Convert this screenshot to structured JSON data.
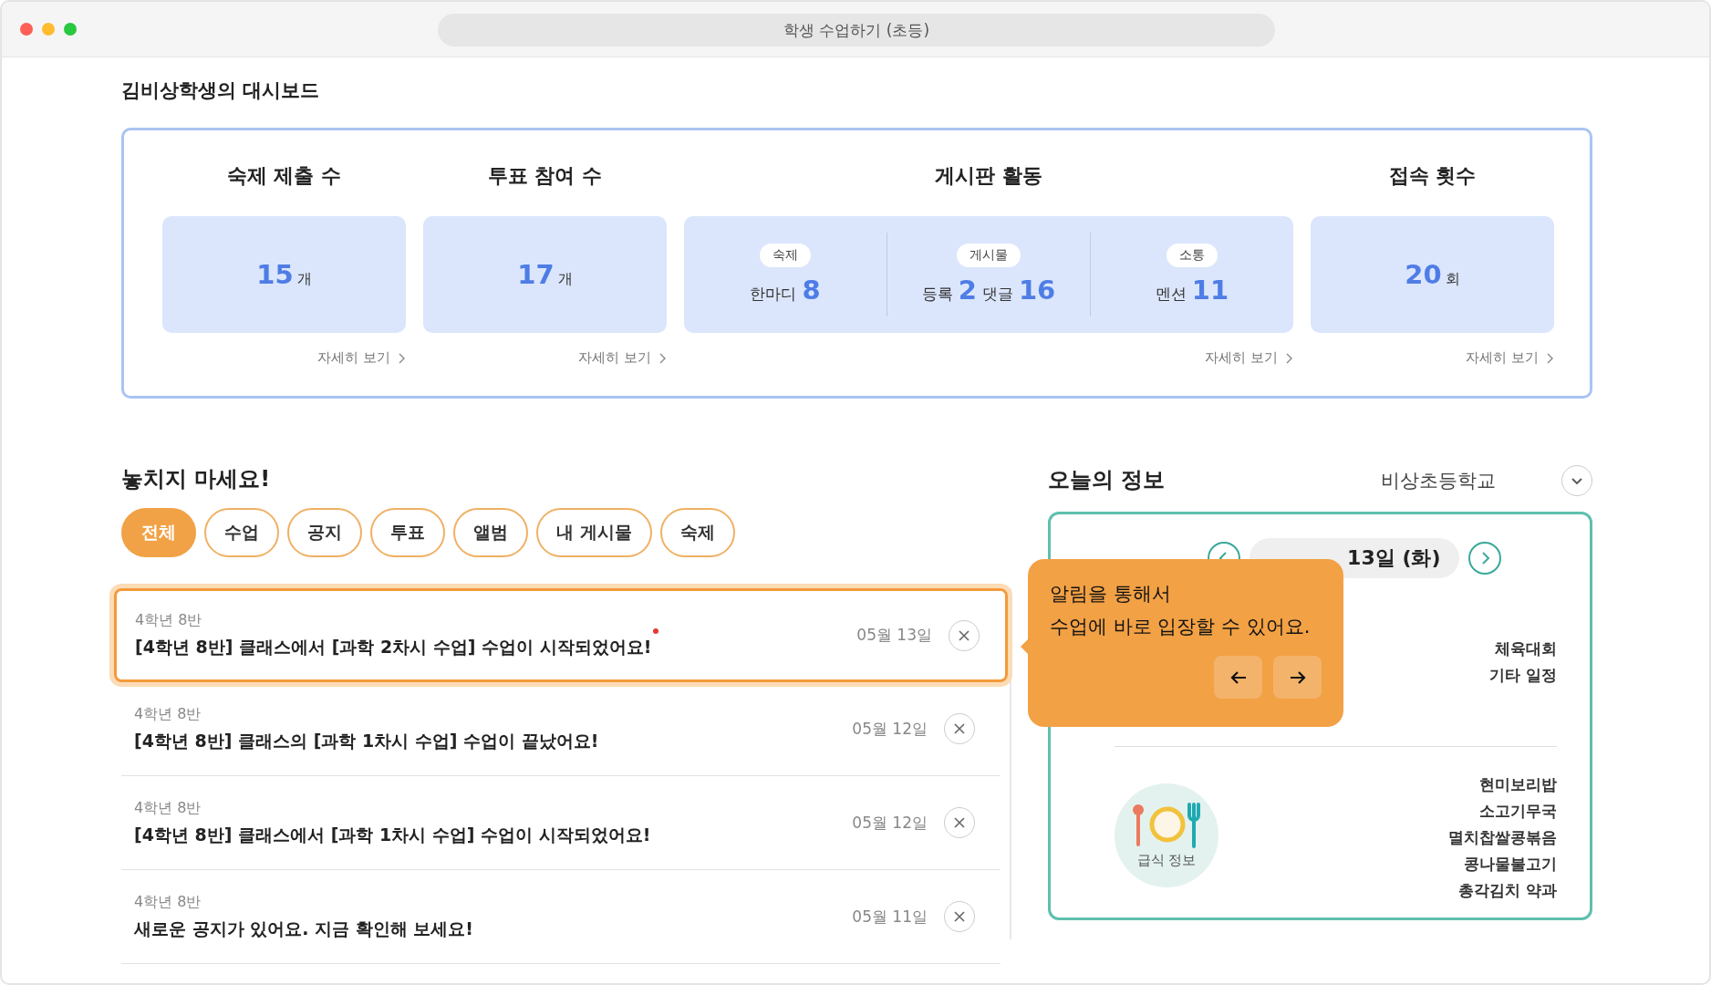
{
  "window": {
    "title": "학생 수업하기 (초등)"
  },
  "dashboard": {
    "title": "김비상학생의 대시보드",
    "stats": [
      {
        "kind": "single",
        "title": "숙제 제출 수",
        "value": "15",
        "unit": "개",
        "link": "자세히 보기"
      },
      {
        "kind": "single",
        "title": "투표 참여 수",
        "value": "17",
        "unit": "개",
        "link": "자세히 보기"
      },
      {
        "kind": "group",
        "title": "게시판 활동",
        "link": "자세히 보기",
        "groups": [
          {
            "tag": "숙제",
            "parts": [
              {
                "label": "한마디",
                "value": "8"
              }
            ]
          },
          {
            "tag": "게시물",
            "parts": [
              {
                "label": "등록",
                "value": "2"
              },
              {
                "label": "댓글",
                "value": "16"
              }
            ]
          },
          {
            "tag": "소통",
            "parts": [
              {
                "label": "멘션",
                "value": "11"
              }
            ]
          }
        ]
      },
      {
        "kind": "single",
        "title": "접속 횟수",
        "value": "20",
        "unit": "회",
        "link": "자세히 보기"
      }
    ]
  },
  "alerts": {
    "title": "놓치지 마세요!",
    "filters": [
      {
        "label": "전체",
        "selected": true
      },
      {
        "label": "수업",
        "selected": false
      },
      {
        "label": "공지",
        "selected": false
      },
      {
        "label": "투표",
        "selected": false
      },
      {
        "label": "앨범",
        "selected": false
      },
      {
        "label": "내 게시물",
        "selected": false
      },
      {
        "label": "숙제",
        "selected": false
      }
    ],
    "items": [
      {
        "class": "4학년 8반",
        "message": "[4학년 8반] 클래스에서 [과학 2차시 수업] 수업이 시작되었어요!",
        "date": "05월 13일",
        "highlighted": true,
        "unread": true
      },
      {
        "class": "4학년 8반",
        "message": "[4학년 8반] 클래스의 [과학 1차시 수업] 수업이 끝났어요!",
        "date": "05월 12일",
        "highlighted": false,
        "unread": false
      },
      {
        "class": "4학년 8반",
        "message": "[4학년 8반] 클래스에서 [과학 1차시 수업] 수업이 시작되었어요!",
        "date": "05월 12일",
        "highlighted": false,
        "unread": false
      },
      {
        "class": "4학년 8반",
        "message": "새로운 공지가 있어요. 지금 확인해 보세요!",
        "date": "05월 11일",
        "highlighted": false,
        "unread": false
      }
    ]
  },
  "today": {
    "title": "오늘의 정보",
    "school": "비상초등학교",
    "date": "13일 (화)",
    "schedule": [
      "체육대회",
      "기타 일정"
    ],
    "meal": {
      "label": "급식 정보",
      "menu": [
        "현미보리밥",
        "소고기무국",
        "멸치찹쌀콩볶음",
        "콩나물불고기",
        "총각김치 약과"
      ]
    }
  },
  "tooltip": {
    "lines": [
      "알림을 통해서",
      "수업에 바로 입장할 수 있어요."
    ]
  }
}
